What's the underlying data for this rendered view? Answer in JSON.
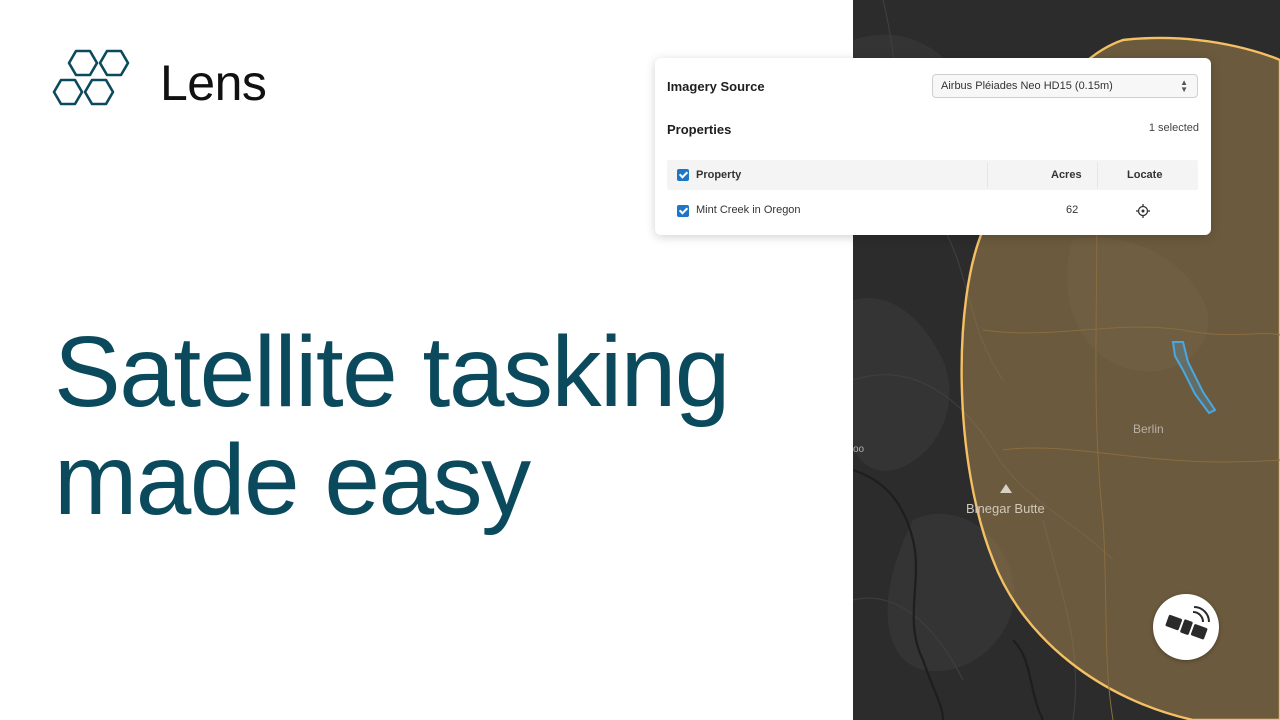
{
  "brand": {
    "name": "Lens",
    "logo_icon": "hexagon-cluster-icon",
    "color": "#0b4a5c"
  },
  "headline": {
    "line1": "Satellite tasking",
    "line2": "made easy",
    "color": "#0b4a5c"
  },
  "panel": {
    "imagery_source_label": "Imagery Source",
    "imagery_source_value": "Airbus Pléiades Neo HD15 (0.15m)",
    "properties_label": "Properties",
    "selected_count": "1 selected",
    "table": {
      "columns": [
        "Property",
        "Acres",
        "Locate"
      ],
      "rows": [
        {
          "property": "Mint Creek in Oregon",
          "acres": "62",
          "checked": true,
          "locate_icon": "crosshair-icon"
        }
      ]
    }
  },
  "map": {
    "labels": {
      "town": "Berlin",
      "peak": "Binegar Butte",
      "edge": "oo"
    },
    "coverage_color": "#f4c063",
    "parcel_color": "#4aa8e0",
    "satellite_button_icon": "satellite-icon"
  }
}
